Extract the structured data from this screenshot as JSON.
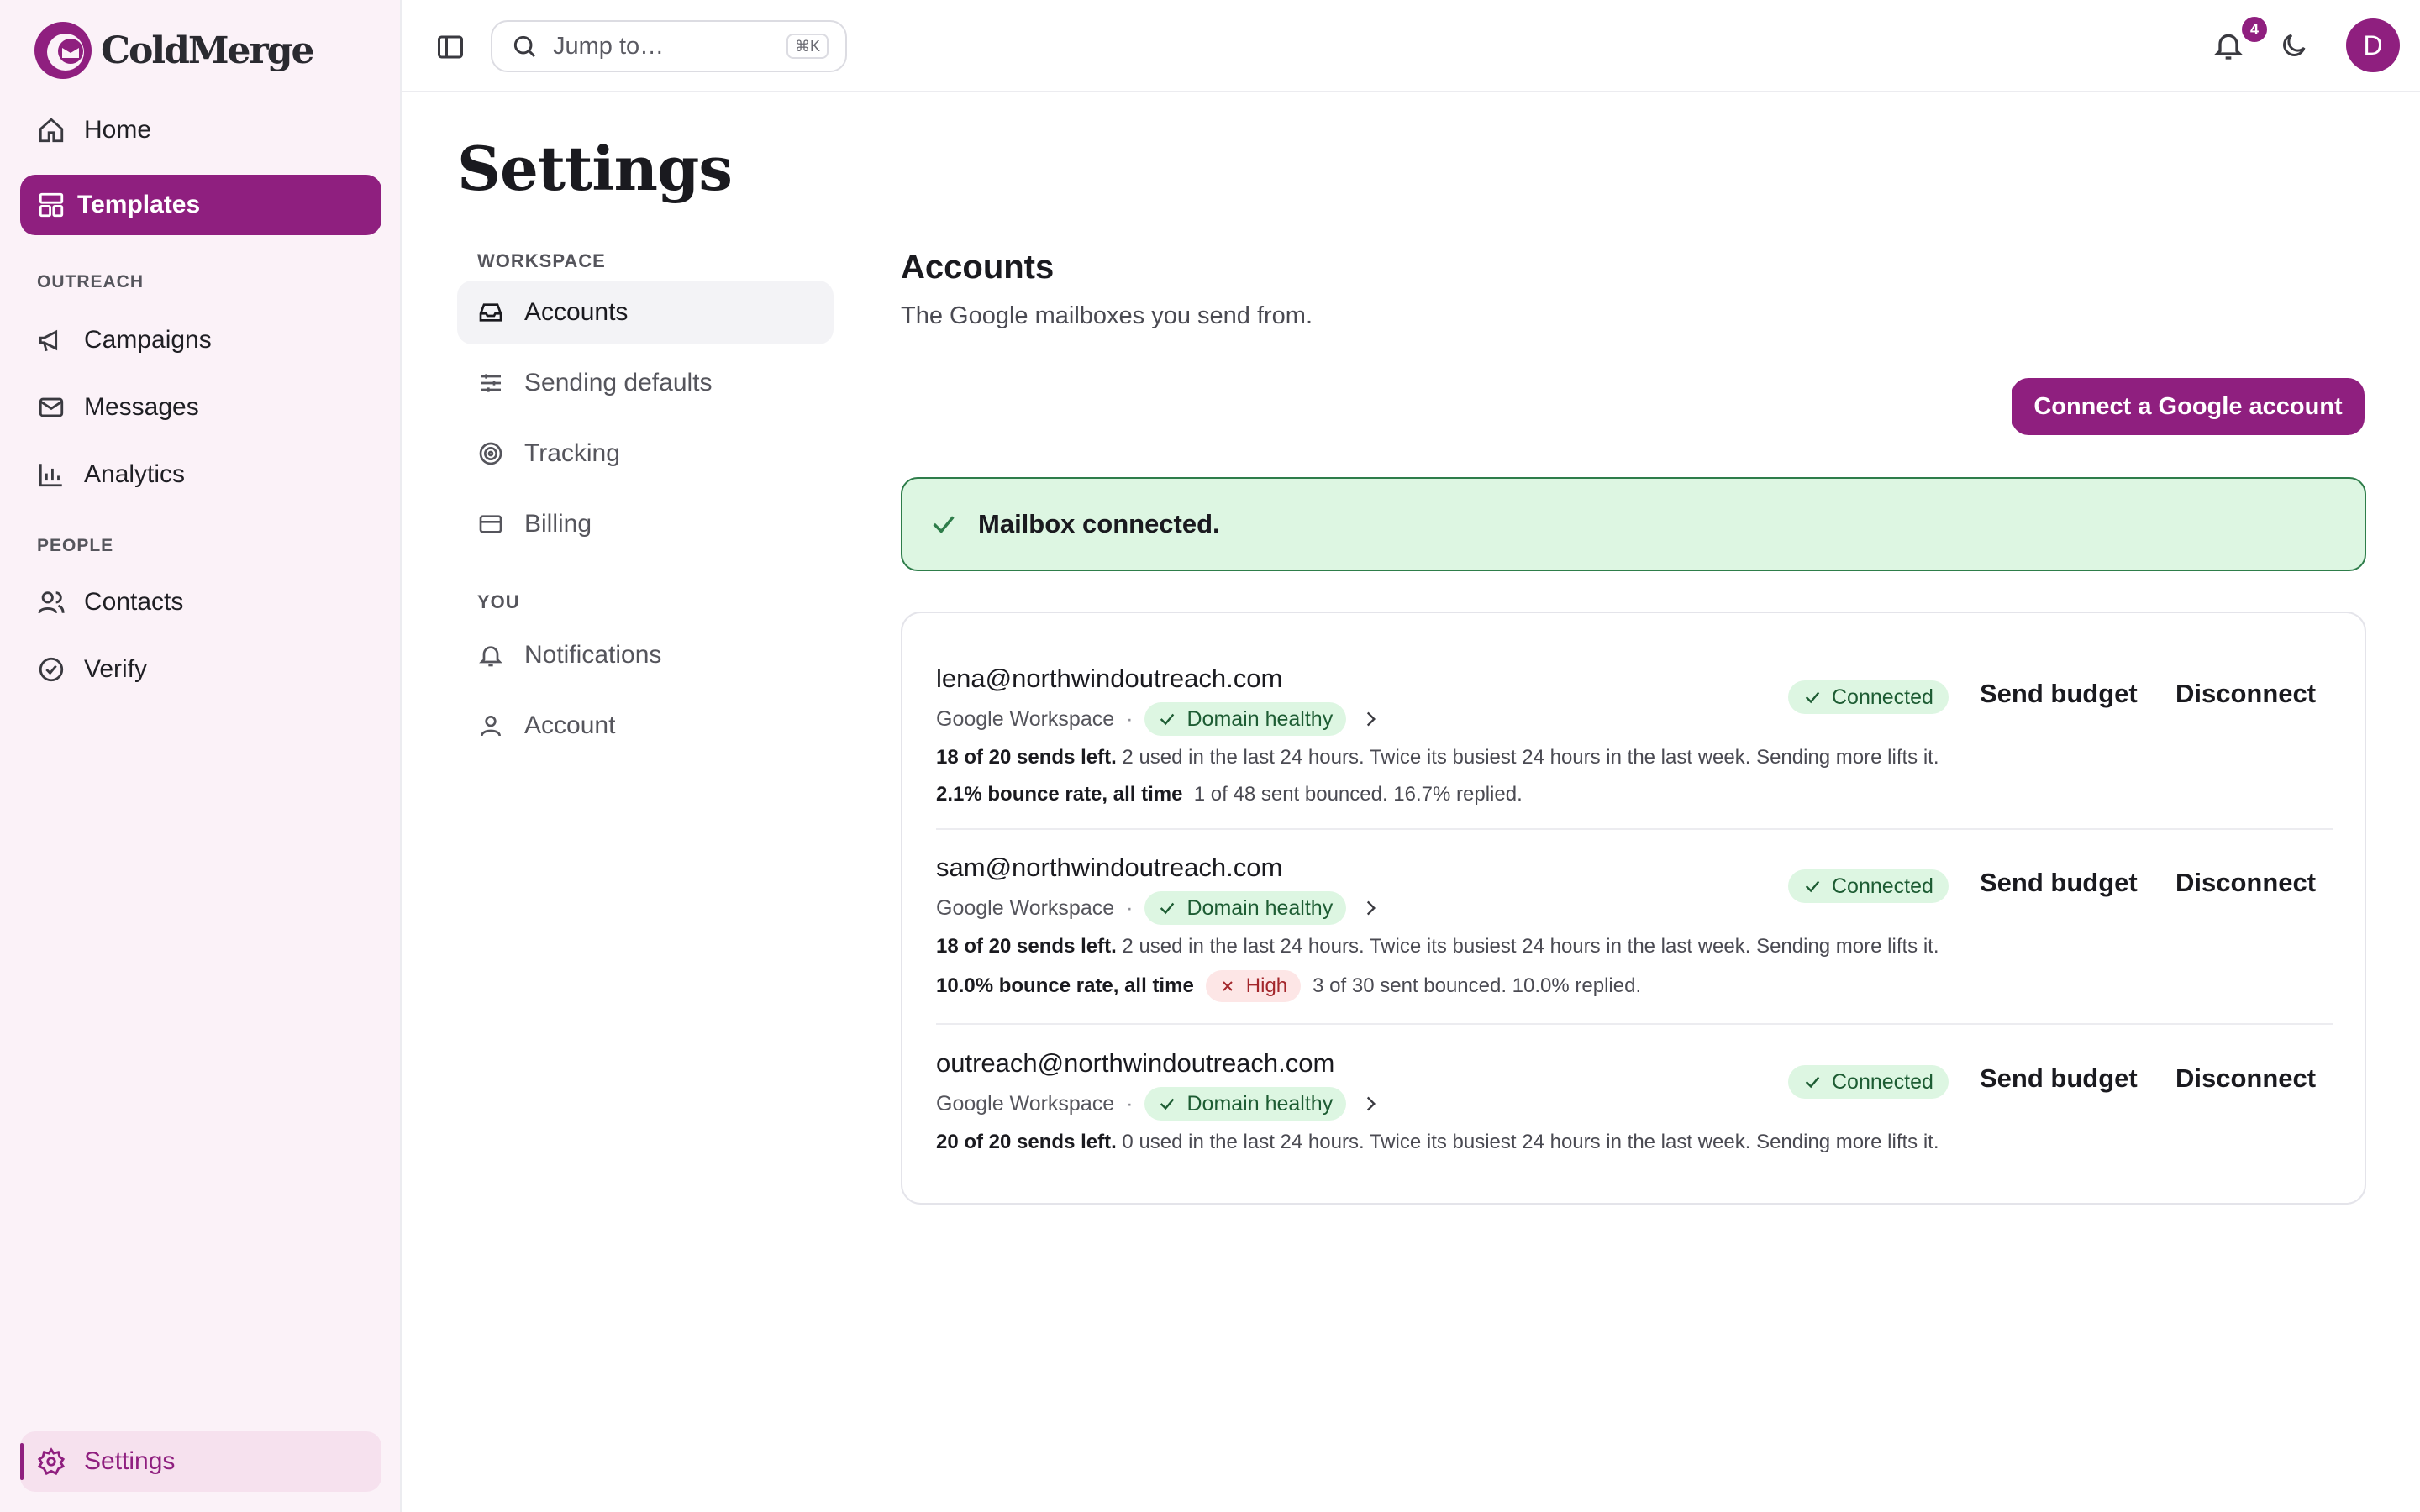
{
  "brand": {
    "name": "ColdMerge",
    "accent": "#8f1f7f"
  },
  "sidebar": {
    "home": "Home",
    "templates": "Templates",
    "section_outreach": "OUTREACH",
    "campaigns": "Campaigns",
    "messages": "Messages",
    "analytics": "Analytics",
    "section_people": "PEOPLE",
    "contacts": "Contacts",
    "verify": "Verify",
    "settings": "Settings"
  },
  "topbar": {
    "search_placeholder": "Jump to…",
    "shortcut": "⌘K",
    "notification_count": "4",
    "avatar_initial": "D"
  },
  "page": {
    "title": "Settings"
  },
  "settings_nav": {
    "section_workspace": "WORKSPACE",
    "accounts": "Accounts",
    "sending_defaults": "Sending defaults",
    "tracking": "Tracking",
    "billing": "Billing",
    "section_you": "YOU",
    "notifications": "Notifications",
    "account": "Account"
  },
  "accounts": {
    "title": "Accounts",
    "description": "The Google mailboxes you send from.",
    "connect_button": "Connect a Google account",
    "alert": "Mailbox connected.",
    "list": [
      {
        "email": "lena@northwindoutreach.com",
        "provider": "Google Workspace",
        "domain_status": "Domain healthy",
        "status": "Connected",
        "budget_label": "Send budget",
        "disconnect_label": "Disconnect",
        "sends_left": "18 of 20 sends left.",
        "sends_detail": "2 used in the last 24 hours. Twice its busiest 24 hours in the last week. Sending more lifts it.",
        "bounce": "2.1% bounce rate, all time",
        "bounce_detail": "1 of 48 sent bounced. 16.7% replied."
      },
      {
        "email": "sam@northwindoutreach.com",
        "provider": "Google Workspace",
        "domain_status": "Domain healthy",
        "status": "Connected",
        "budget_label": "Send budget",
        "disconnect_label": "Disconnect",
        "sends_left": "18 of 20 sends left.",
        "sends_detail": "2 used in the last 24 hours. Twice its busiest 24 hours in the last week. Sending more lifts it.",
        "bounce": "10.0% bounce rate, all time",
        "bounce_flag": "High",
        "bounce_detail": "3 of 30 sent bounced. 10.0% replied."
      },
      {
        "email": "outreach@northwindoutreach.com",
        "provider": "Google Workspace",
        "domain_status": "Domain healthy",
        "status": "Connected",
        "budget_label": "Send budget",
        "disconnect_label": "Disconnect",
        "sends_left": "20 of 20 sends left.",
        "sends_detail": "0 used in the last 24 hours. Twice its busiest 24 hours in the last week. Sending more lifts it."
      }
    ]
  }
}
